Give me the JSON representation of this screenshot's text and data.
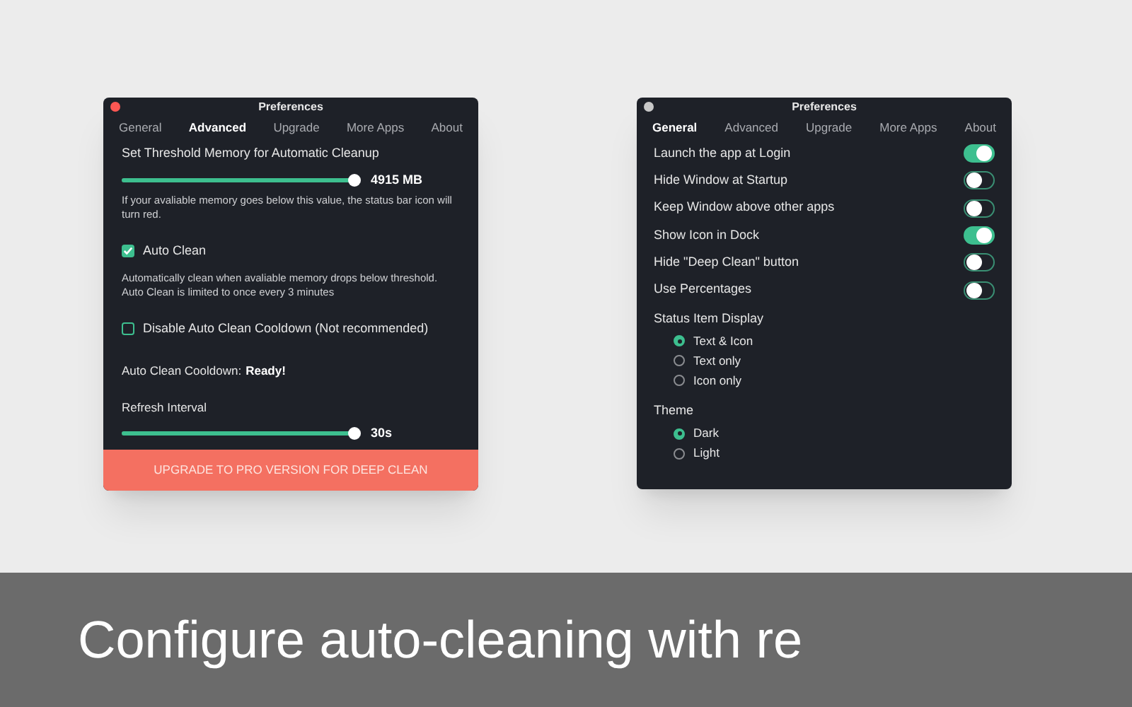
{
  "left_window": {
    "title": "Preferences",
    "focused": true,
    "tabs": [
      {
        "label": "General",
        "selected": false
      },
      {
        "label": "Advanced",
        "selected": true
      },
      {
        "label": "Upgrade",
        "selected": false
      },
      {
        "label": "More Apps",
        "selected": false
      },
      {
        "label": "About",
        "selected": false
      }
    ],
    "threshold": {
      "label": "Set Threshold Memory for Automatic Cleanup",
      "level": 1.0,
      "reading": "4915 MB",
      "note": "If your avaliable memory goes below this value, the status bar icon will turn red."
    },
    "auto_clean": {
      "label": "Auto Clean",
      "checked": true,
      "note": "Automatically clean when avaliable memory drops below threshold. Auto Clean is limited to once every 3 minutes"
    },
    "disable_cooldown": {
      "label": "Disable Auto Clean Cooldown (Not recommended)",
      "checked": false
    },
    "cooldown_status": {
      "label": "Auto Clean Cooldown:",
      "value": "Ready!"
    },
    "refresh": {
      "label": "Refresh Interval",
      "level": 1.0,
      "reading": "30s"
    },
    "upgrade_button": "UPGRADE TO PRO VERSION FOR DEEP CLEAN"
  },
  "right_window": {
    "title": "Preferences",
    "focused": false,
    "tabs": [
      {
        "label": "General",
        "selected": true
      },
      {
        "label": "Advanced",
        "selected": false
      },
      {
        "label": "Upgrade",
        "selected": false
      },
      {
        "label": "More Apps",
        "selected": false
      },
      {
        "label": "About",
        "selected": false
      }
    ],
    "toggles": [
      {
        "label": "Launch the app at Login",
        "on": true
      },
      {
        "label": "Hide Window at Startup",
        "on": false
      },
      {
        "label": "Keep Window above other apps",
        "on": false
      },
      {
        "label": "Show Icon in Dock",
        "on": true
      },
      {
        "label": "Hide \"Deep Clean\" button",
        "on": false
      },
      {
        "label": "Use Percentages",
        "on": false
      }
    ],
    "groups": [
      {
        "title": "Status Item Display",
        "options": [
          {
            "label": "Text & Icon",
            "selected": true
          },
          {
            "label": "Text only",
            "selected": false
          },
          {
            "label": "Icon only",
            "selected": false
          }
        ]
      },
      {
        "title": "Theme",
        "options": [
          {
            "label": "Dark",
            "selected": true
          },
          {
            "label": "Light",
            "selected": false
          }
        ]
      }
    ]
  },
  "caption": "Configure auto-cleaning with re"
}
